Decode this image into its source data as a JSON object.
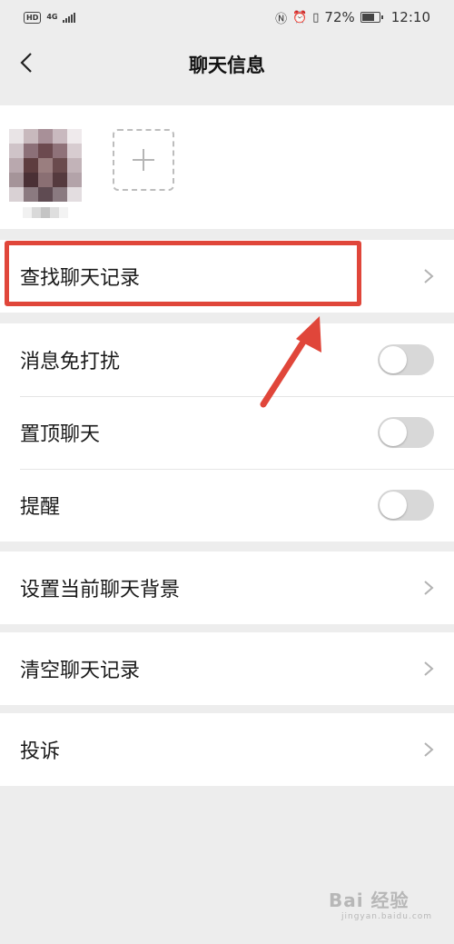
{
  "status_bar": {
    "hd": "HD",
    "network": "4G",
    "battery": "72%",
    "time": "12:10"
  },
  "nav": {
    "title": "聊天信息"
  },
  "cells": {
    "search_history": "查找聊天记录",
    "mute": "消息免打扰",
    "sticky": "置顶聊天",
    "remind": "提醒",
    "set_background": "设置当前聊天背景",
    "clear_history": "清空聊天记录",
    "complain": "投诉"
  },
  "toggles": {
    "mute_on": false,
    "sticky_on": false,
    "remind_on": false
  },
  "colors": {
    "annotation_red": "#e0463a",
    "toggle_off": "#d8d8d8",
    "background": "#ededed"
  },
  "watermark": {
    "main": "Bai 经验",
    "sub": "jingyan.baidu.com"
  }
}
